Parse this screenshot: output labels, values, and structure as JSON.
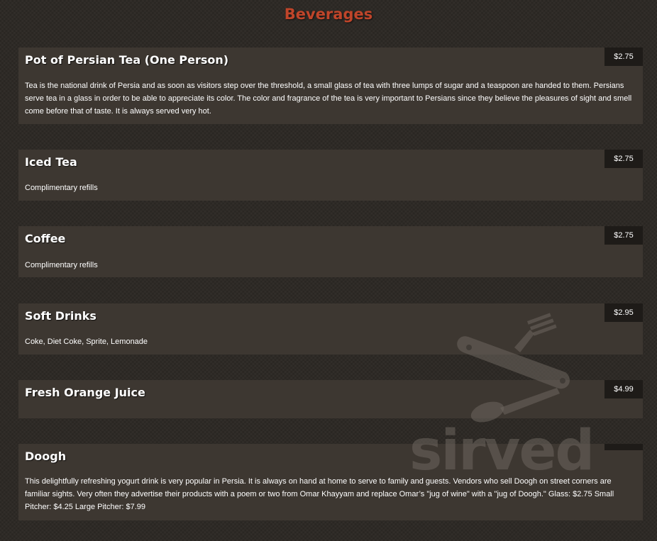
{
  "menu": {
    "section_title": "Beverages",
    "items": [
      {
        "name": "Pot of Persian Tea (One Person)",
        "price": "$2.75",
        "description": "Tea is the national drink of Persia and as soon as visitors step over the threshold, a small glass of tea with three lumps of sugar and a teaspoon are handed to them. Persians serve tea in a glass in order to be able to appreciate its color. The color and fragrance of the tea is very important to Persians since they believe the pleasures of sight and smell come before that of taste. It is always served very hot."
      },
      {
        "name": "Iced Tea",
        "price": "$2.75",
        "description": "Complimentary refills"
      },
      {
        "name": "Coffee",
        "price": "$2.75",
        "description": "Complimentary refills"
      },
      {
        "name": "Soft Drinks",
        "price": "$2.95",
        "description": "Coke, Diet Coke, Sprite, Lemonade"
      },
      {
        "name": "Fresh Orange Juice",
        "price": "$4.99",
        "description": ""
      },
      {
        "name": "Doogh",
        "price": "",
        "description": "This delightfully refreshing yogurt drink is very popular in Persia. It is always on hand at home to serve to family and guests. Vendors who sell Doogh on street corners are familiar sights. Very often they advertise their products with a poem or two from Omar Khayyam and replace Omar’s \"jug of wine\" with a \"jug of Doogh.\" Glass: $2.75 Small Pitcher: $4.25 Large Pitcher: $7.99"
      }
    ]
  },
  "watermark": {
    "text": "sirved",
    "icon": "fork-spoon-pocketknife-icon"
  },
  "colors": {
    "background": "#2e2a26",
    "card": "#3d3731",
    "price_tag": "#1e1b18",
    "title": "#c0452a",
    "text": "#ffffff"
  }
}
